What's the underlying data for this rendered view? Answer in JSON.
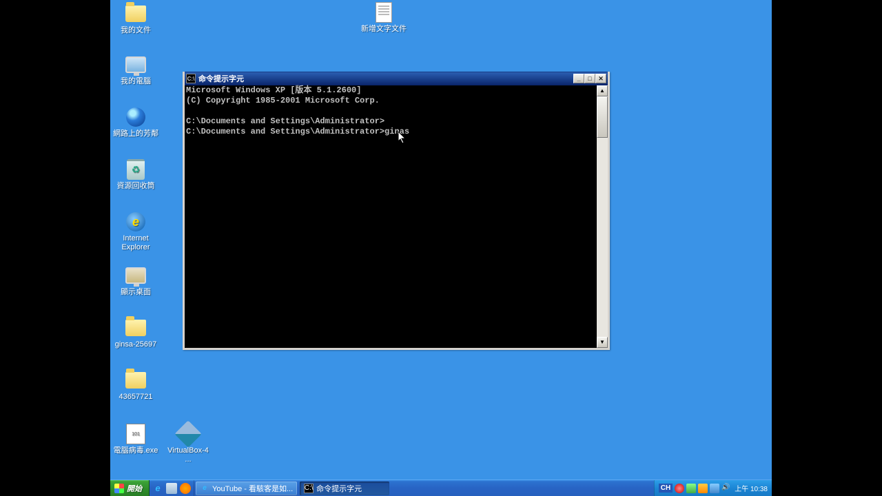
{
  "desktop_icons": {
    "col1": [
      {
        "label": "我的文件"
      },
      {
        "label": "我的電腦"
      },
      {
        "label": "網路上的芳鄰"
      },
      {
        "label": "資源回收筒"
      },
      {
        "label": "Internet Explorer"
      },
      {
        "label": "顯示桌面"
      },
      {
        "label": "ginsa-25697"
      },
      {
        "label": "43657721"
      },
      {
        "label": "電腦病毒.exe"
      }
    ],
    "col2": [
      {
        "label": "VirtualBox-4 ..."
      }
    ],
    "top": [
      {
        "label": "新增文字文件"
      }
    ]
  },
  "cmd_window": {
    "title": "命令提示字元",
    "lines": {
      "l1": "Microsoft Windows XP [版本 5.1.2600]",
      "l2": "(C) Copyright 1985-2001 Microsoft Corp.",
      "l3": "",
      "l4": "C:\\Documents and Settings\\Administrator>",
      "l5": "C:\\Documents and Settings\\Administrator>ginas"
    }
  },
  "taskbar": {
    "start": "開始",
    "task1": "YouTube - 看駭客是如...",
    "task2": "命令提示字元",
    "lang": "CH",
    "clock": "上午 10:38"
  }
}
